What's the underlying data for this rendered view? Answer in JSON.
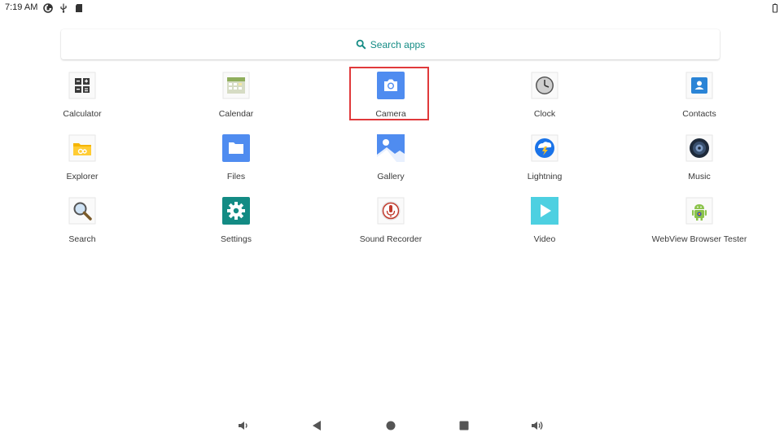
{
  "status_bar": {
    "time": "7:19 AM",
    "icons": [
      "data-saver-icon",
      "usb-icon",
      "sd-card-icon"
    ],
    "battery_icon": "battery-icon"
  },
  "search": {
    "placeholder": "Search apps",
    "accent": "#138b84"
  },
  "apps": [
    {
      "label": "Calculator",
      "icon": "calculator-icon"
    },
    {
      "label": "Calendar",
      "icon": "calendar-icon"
    },
    {
      "label": "Camera",
      "icon": "camera-icon",
      "highlighted": true
    },
    {
      "label": "Clock",
      "icon": "clock-icon"
    },
    {
      "label": "Contacts",
      "icon": "contacts-icon"
    },
    {
      "label": "Explorer",
      "icon": "explorer-icon"
    },
    {
      "label": "Files",
      "icon": "files-icon"
    },
    {
      "label": "Gallery",
      "icon": "gallery-icon"
    },
    {
      "label": "Lightning",
      "icon": "lightning-icon"
    },
    {
      "label": "Music",
      "icon": "music-icon"
    },
    {
      "label": "Search",
      "icon": "magnifier-icon"
    },
    {
      "label": "Settings",
      "icon": "settings-gear-icon"
    },
    {
      "label": "Sound Recorder",
      "icon": "microphone-icon"
    },
    {
      "label": "Video",
      "icon": "video-play-icon"
    },
    {
      "label": "WebView Browser Tester",
      "icon": "android-robot-icon"
    }
  ],
  "highlight_color": "#e0393b",
  "nav_bar": [
    "volume-down-icon",
    "back-icon",
    "home-icon",
    "recents-icon",
    "volume-up-icon"
  ]
}
